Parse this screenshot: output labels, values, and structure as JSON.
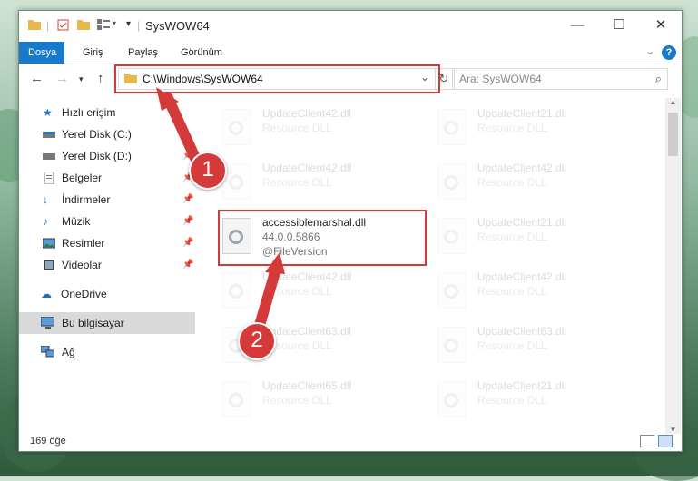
{
  "window": {
    "title": "SysWOW64"
  },
  "ribbon": {
    "tabs": [
      "Dosya",
      "Giriş",
      "Paylaş",
      "Görünüm"
    ],
    "help": "?"
  },
  "address": {
    "path": "C:\\Windows\\SysWOW64",
    "search_placeholder": "Ara: SysWOW64"
  },
  "sidebar": {
    "items": [
      {
        "label": "Hızlı erişim",
        "icon": "star-icon"
      },
      {
        "label": "Yerel Disk (C:)",
        "icon": "drive-icon"
      },
      {
        "label": "Yerel Disk (D:)",
        "icon": "drive-icon"
      },
      {
        "label": "Belgeler",
        "icon": "document-icon"
      },
      {
        "label": "İndirmeler",
        "icon": "download-icon"
      },
      {
        "label": "Müzik",
        "icon": "music-icon"
      },
      {
        "label": "Resimler",
        "icon": "pictures-icon"
      },
      {
        "label": "Videolar",
        "icon": "video-icon"
      },
      {
        "label": "OneDrive",
        "icon": "cloud-icon"
      },
      {
        "label": "Bu bilgisayar",
        "icon": "computer-icon"
      },
      {
        "label": "Ağ",
        "icon": "network-icon"
      }
    ]
  },
  "files": {
    "left": [
      {
        "name": "UpdateClient42.dll",
        "type": "Resource DLL"
      },
      {
        "name": "UpdateClient42.dll",
        "type": "Resource DLL"
      },
      {
        "name": "accessiblemarshal.dll",
        "type": "44.0.0.5866",
        "extra": "@FileVersion"
      },
      {
        "name": "UpdateClient42.dll",
        "type": "Resource DLL"
      },
      {
        "name": "UpdateClient63.dll",
        "type": "Resource DLL"
      },
      {
        "name": "UpdateClient65.dll",
        "type": "Resource DLL"
      }
    ],
    "right": [
      {
        "name": "UpdateClient21.dll",
        "type": "Resource DLL"
      },
      {
        "name": "UpdateClient42.dll",
        "type": "Resource DLL"
      },
      {
        "name": "UpdateClient21.dll",
        "type": "Resource DLL"
      },
      {
        "name": "UpdateClient42.dll",
        "type": "Resource DLL"
      },
      {
        "name": "UpdateClient63.dll",
        "type": "Resource DLL"
      },
      {
        "name": "UpdateClient21.dll",
        "type": "Resource DLL"
      }
    ]
  },
  "status": {
    "count": "169 öğe"
  },
  "callouts": [
    "1",
    "2"
  ],
  "colors": {
    "accent": "#1979ca",
    "highlight": "#d43a3a"
  }
}
